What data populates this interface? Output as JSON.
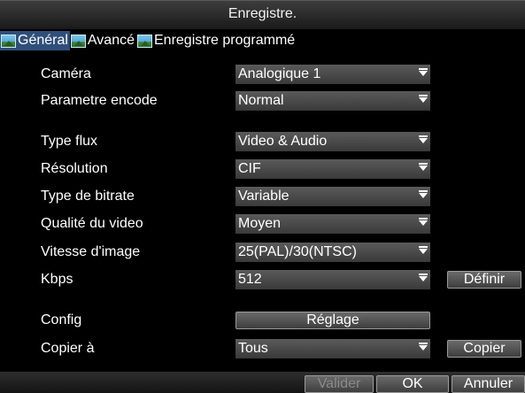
{
  "window": {
    "title": "Enregistre."
  },
  "tabs": [
    {
      "label": "Général",
      "icon": "landscape-icon",
      "active": true
    },
    {
      "label": "Avancé",
      "icon": "landscape-icon",
      "active": false
    },
    {
      "label": "Enregistre programmé",
      "icon": "landscape-icon",
      "active": false
    }
  ],
  "fields": {
    "camera": {
      "label": "Caméra",
      "value": "Analogique 1"
    },
    "parametre_encode": {
      "label": "Parametre encode",
      "value": "Normal"
    },
    "type_flux": {
      "label": "Type flux",
      "value": "Video & Audio"
    },
    "resolution": {
      "label": "Résolution",
      "value": "CIF"
    },
    "type_bitrate": {
      "label": "Type de bitrate",
      "value": "Variable"
    },
    "qualite_video": {
      "label": "Qualité du video",
      "value": "Moyen"
    },
    "vitesse_image": {
      "label": "Vitesse d'image",
      "value": "25(PAL)/30(NTSC)"
    },
    "kbps": {
      "label": "Kbps",
      "value": "512",
      "button": "Définir"
    },
    "config": {
      "label": "Config",
      "button": "Réglage"
    },
    "copier": {
      "label": "Copier à",
      "value": "Tous",
      "button": "Copier"
    }
  },
  "footer": {
    "valider": "Valider",
    "ok": "OK",
    "annuler": "Annuler"
  },
  "colors": {
    "active_tab": "#2f4f7a",
    "background": "#000000",
    "select_bg": "#4a4a4a"
  }
}
